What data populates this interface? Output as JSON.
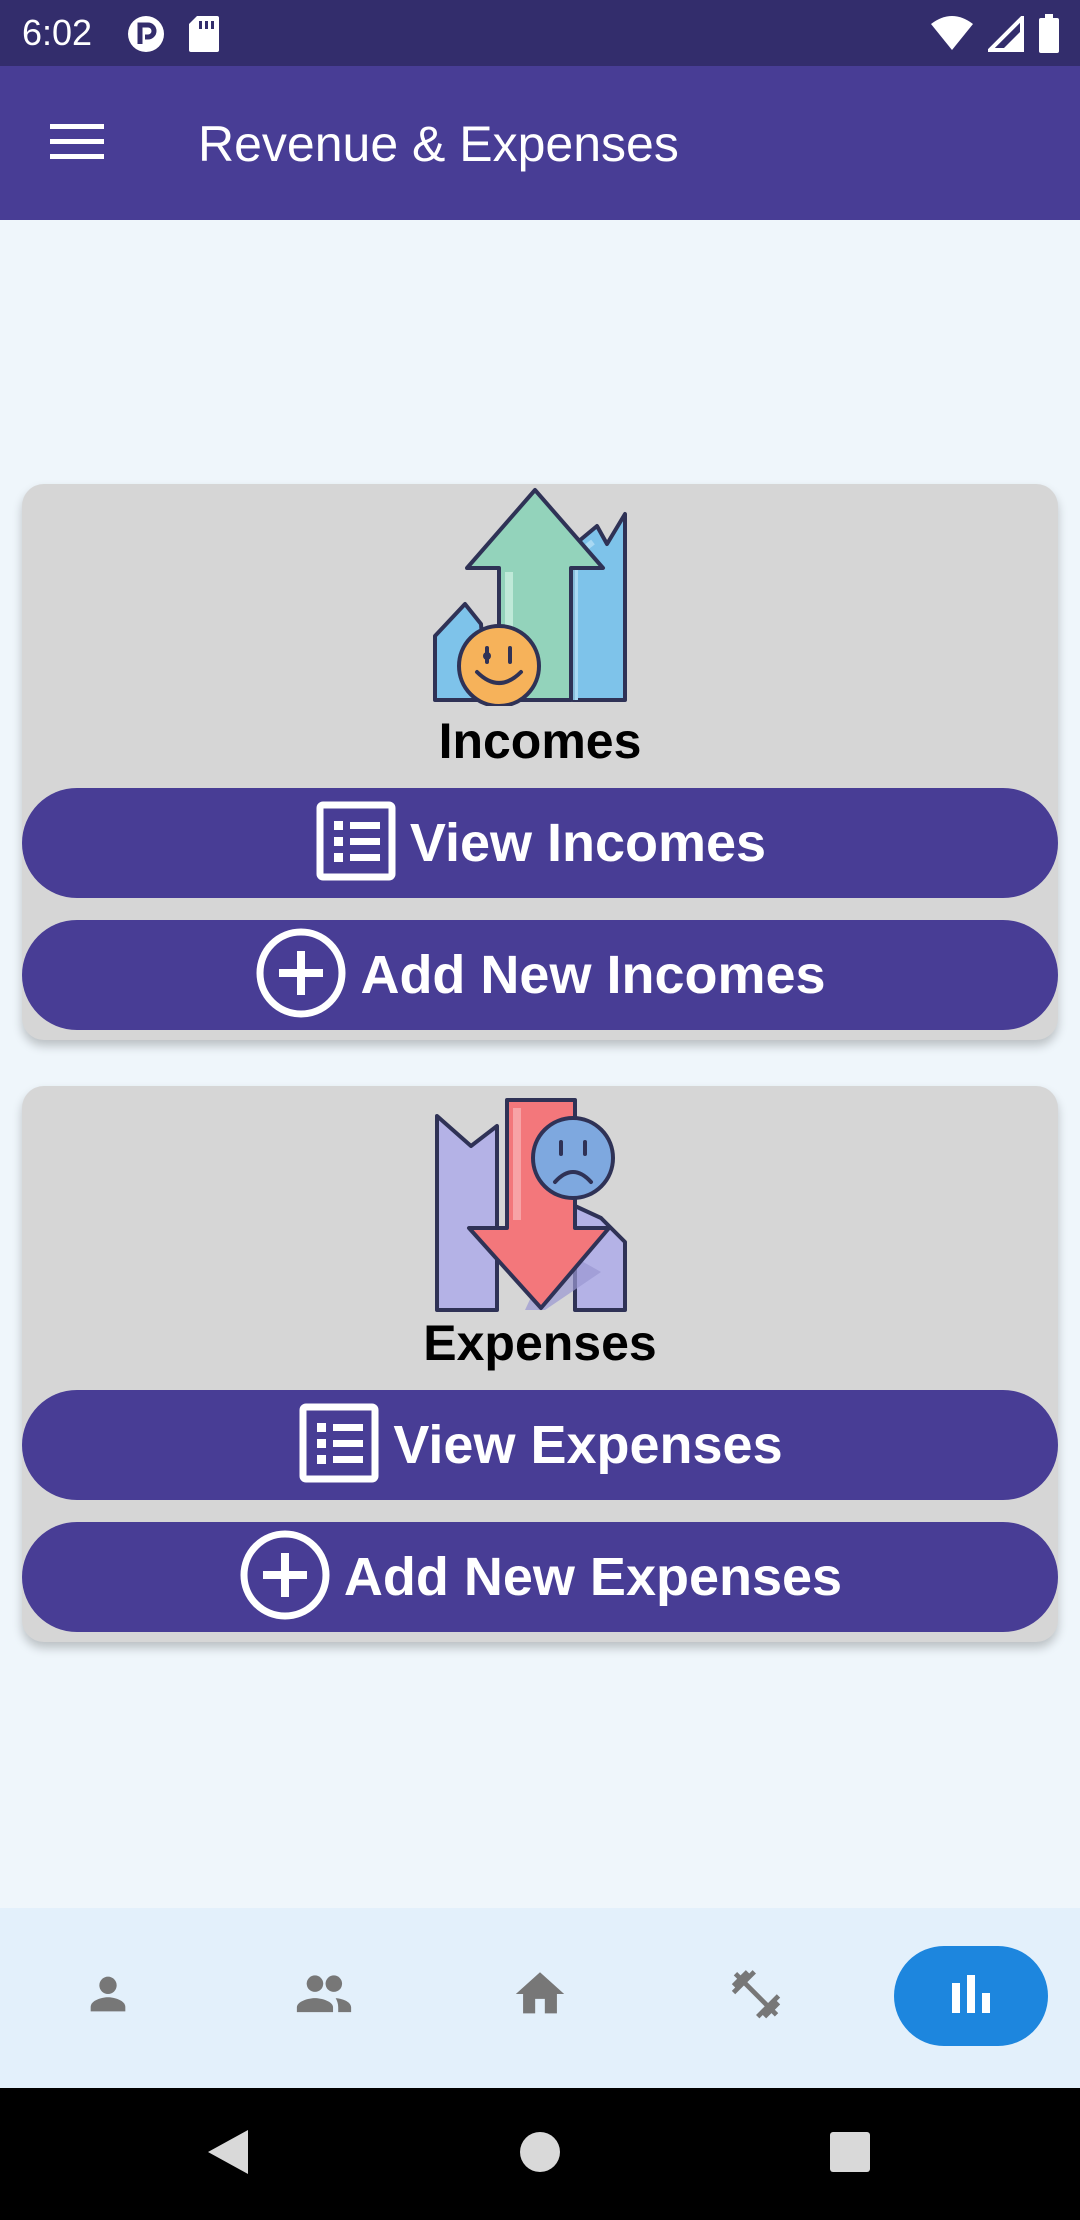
{
  "status_bar": {
    "time": "6:02",
    "icons_left": [
      "notification-icon",
      "sd-card-icon"
    ],
    "icons_right": [
      "wifi-icon",
      "signal-icon",
      "battery-icon"
    ]
  },
  "app_bar": {
    "title": "Revenue & Expenses",
    "menu_icon": "hamburger-menu-icon"
  },
  "incomes_card": {
    "title": "Incomes",
    "illustration": "rising-chart-smiley-illustration",
    "view_label": "View Incomes",
    "view_icon": "list-icon",
    "add_label": "Add New Incomes",
    "add_icon": "add-circle-icon"
  },
  "expenses_card": {
    "title": "Expenses",
    "illustration": "falling-chart-sad-illustration",
    "view_label": "View Expenses",
    "view_icon": "list-icon",
    "add_label": "Add New Expenses",
    "add_icon": "add-circle-icon"
  },
  "bottom_nav": {
    "items": [
      {
        "icon": "person-icon",
        "active": false
      },
      {
        "icon": "group-icon",
        "active": false
      },
      {
        "icon": "home-icon",
        "active": false
      },
      {
        "icon": "dumbbell-icon",
        "active": false
      },
      {
        "icon": "bar-chart-icon",
        "active": true
      }
    ]
  },
  "colors": {
    "status_bar": "#332d6c",
    "primary": "#483d95",
    "background": "#eff6fb",
    "card": "#d6d6d6",
    "nav_background": "#e3f0fb",
    "nav_active": "#1d86de",
    "nav_icon": "#777777"
  }
}
